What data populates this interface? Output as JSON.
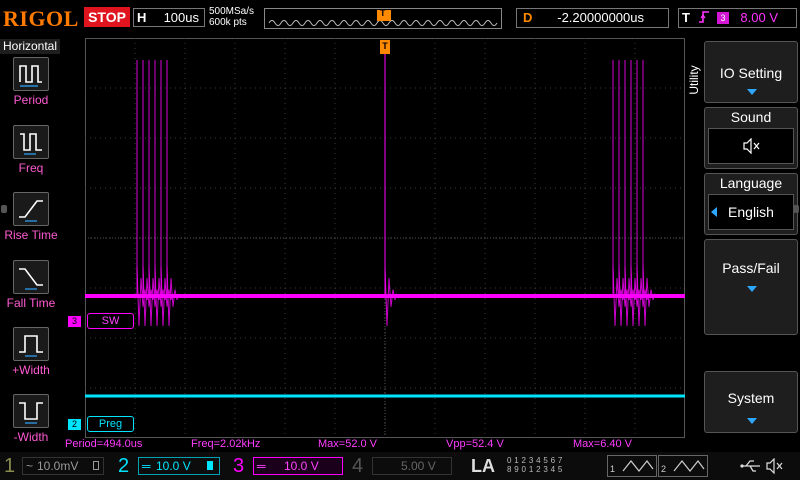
{
  "topbar": {
    "brand": "RIGOL",
    "run_state": "STOP",
    "timebase_label": "H",
    "timebase_value": "100us",
    "sample_rate": "500MSa/s",
    "memory_depth": "600k pts",
    "trigger_marker": "T",
    "delay_label": "D",
    "delay_value": "-2.20000000us",
    "trigger_label": "T",
    "trigger_edge_icon": "rising-edge-icon",
    "trigger_source": "3",
    "trigger_level": "8.00 V"
  },
  "left_menu": {
    "title": "Horizontal",
    "items": [
      {
        "label": "Period",
        "icon": "period-icon"
      },
      {
        "label": "Freq",
        "icon": "frequency-icon"
      },
      {
        "label": "Rise Time",
        "icon": "rise-time-icon"
      },
      {
        "label": "Fall Time",
        "icon": "fall-time-icon"
      },
      {
        "label": "+Width",
        "icon": "positive-width-icon"
      },
      {
        "label": "-Width",
        "icon": "negative-width-icon"
      }
    ]
  },
  "right_menu": {
    "tab_label": "Utility",
    "buttons": [
      {
        "label": "IO Setting"
      },
      {
        "label": "Sound",
        "value_icon": "speaker-muted-icon"
      },
      {
        "label": "Language",
        "value": "English"
      },
      {
        "label": "Pass/Fail"
      },
      {
        "label": "System"
      }
    ]
  },
  "channels_on_screen": {
    "ch3_marker": "3",
    "ch3_label": "SW",
    "ch2_marker": "2",
    "ch2_label": "Preg",
    "trigger_level_marker": "T"
  },
  "measurements": {
    "period": "Period=494.0us",
    "freq": "Freq=2.02kHz",
    "max": "Max=52.0 V",
    "vpp": "Vpp=52.4 V",
    "max2": "Max=6.40 V"
  },
  "bottom_bar": {
    "ch1": {
      "num": "1",
      "scale": "10.0mV",
      "coupling_icon": "ac-coupling-icon"
    },
    "ch2": {
      "num": "2",
      "scale": "10.0 V",
      "coupling_icon": "dc-coupling-icon"
    },
    "ch3": {
      "num": "3",
      "scale": "10.0 V",
      "coupling_icon": "dc-coupling-icon"
    },
    "ch4": {
      "num": "4",
      "scale": "5.00 V"
    },
    "la_label": "LA",
    "la_digits_1": "0 1 2 3  4 5 6 7",
    "la_digits_2": "8 9 0 1  2 3 4 5",
    "gen1": "1",
    "gen2": "2",
    "usb_icon": "usb-icon",
    "sound_icon": "speaker-muted-icon"
  },
  "colors": {
    "ch1": "#f2f200",
    "ch2": "#00e5ff",
    "ch3": "#ff00ff",
    "ch4": "#2b62ff",
    "grid": "#3a3a3a",
    "accent": "#2ea8ff",
    "trigger": "#ff8a00"
  }
}
